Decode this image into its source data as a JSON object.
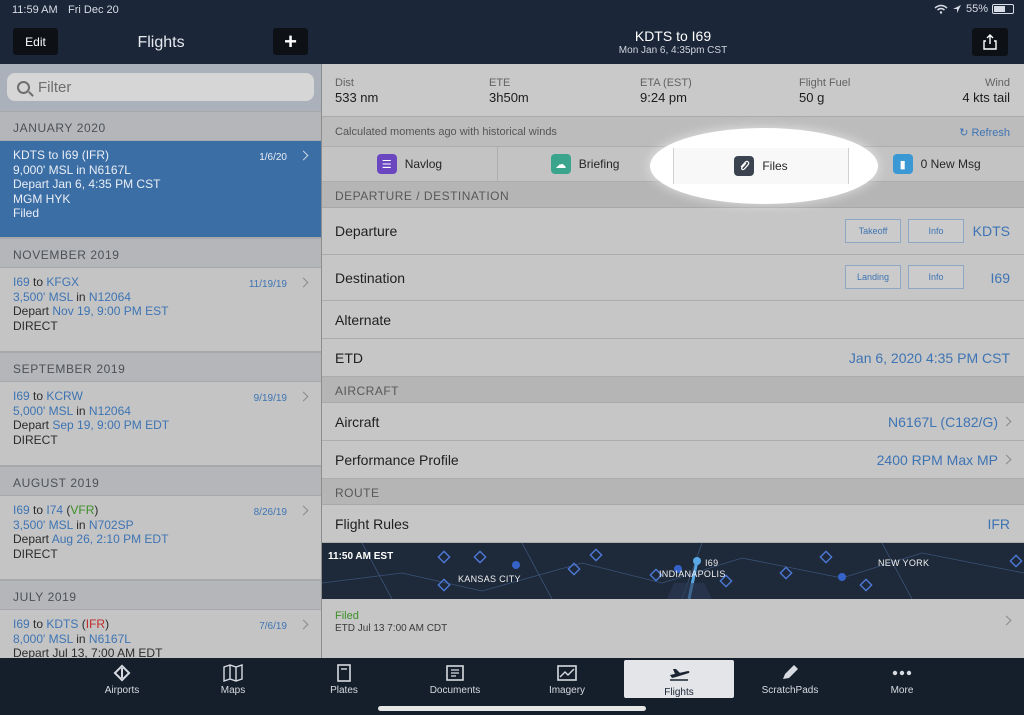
{
  "status": {
    "time": "11:59 AM",
    "date": "Fri Dec 20",
    "battery": "55%",
    "battery_fraction": 0.55
  },
  "left_header": {
    "edit": "Edit",
    "title": "Flights",
    "add": "+"
  },
  "right_header": {
    "title": "KDTS to I69",
    "subtitle": "Mon Jan 6, 4:35pm CST"
  },
  "filter": {
    "placeholder": "Filter"
  },
  "groups": [
    {
      "header": "JANUARY 2020",
      "flights": [
        {
          "route": "KDTS to I69 (IFR)",
          "alt": "9,000' MSL in N6167L",
          "depart": "Depart Jan 6, 4:35 PM CST",
          "extra": "MGM HYK",
          "status": "Filed",
          "date": "1/6/20"
        }
      ]
    },
    {
      "header": "NOVEMBER 2019",
      "flights": [
        {
          "from": "I69",
          "to_word": " to ",
          "dest": "KFGX",
          "alt_val": "3,500' MSL",
          "in": " in ",
          "tail": "N12064",
          "depart_word": "Depart ",
          "depart_val": "Nov 19, 9:00 PM EST",
          "route": "DIRECT",
          "date": "11/19/19"
        }
      ]
    },
    {
      "header": "SEPTEMBER 2019",
      "flights": [
        {
          "from": "I69",
          "to_word": " to ",
          "dest": "KCRW",
          "alt_val": "5,000' MSL",
          "in": " in ",
          "tail": "N12064",
          "depart_word": "Depart ",
          "depart_val": "Sep 19, 9:00 PM EDT",
          "route": "DIRECT",
          "date": "9/19/19"
        }
      ]
    },
    {
      "header": "AUGUST 2019",
      "flights": [
        {
          "from": "I69",
          "to_word": " to ",
          "dest": "I74",
          "rule": "VFR",
          "alt_val": "3,500' MSL",
          "in": " in ",
          "tail": "N702SP",
          "depart_word": "Depart ",
          "depart_val": "Aug 26, 2:10 PM EDT",
          "route": "DIRECT",
          "date": "8/26/19"
        }
      ]
    },
    {
      "header": "JULY 2019",
      "flights": [
        {
          "from": "I69",
          "to_word": " to ",
          "dest": "KDTS",
          "rule": "IFR",
          "alt_val": "8,000' MSL",
          "in": " in ",
          "tail": "N6167L",
          "depart_partial": "Depart Jul 13, 7:00 AM EDT",
          "date": "7/6/19"
        }
      ]
    }
  ],
  "stats": [
    {
      "label": "Dist",
      "value": "533 nm"
    },
    {
      "label": "ETE",
      "value": "3h50m"
    },
    {
      "label": "ETA (EST)",
      "value": "9:24 pm"
    },
    {
      "label": "Flight Fuel",
      "value": "50 g"
    },
    {
      "label": "Wind",
      "value": "4 kts tail"
    }
  ],
  "calc": {
    "text": "Calculated moments ago with historical winds",
    "refresh": "Refresh"
  },
  "tabs": [
    {
      "label": "Navlog",
      "color": "#6b46c1",
      "icon": "list-icon"
    },
    {
      "label": "Briefing",
      "color": "#3aa58c",
      "icon": "cloud-icon"
    },
    {
      "label": "Files",
      "color": "#3b4350",
      "icon": "paperclip-icon"
    },
    {
      "label": "0 New Msg",
      "color": "#3a98d4",
      "icon": "message-icon"
    }
  ],
  "sections": {
    "dep_dest": "DEPARTURE / DESTINATION",
    "aircraft": "AIRCRAFT",
    "route": "ROUTE"
  },
  "rows": {
    "departure": {
      "label": "Departure",
      "btn1": "Takeoff",
      "btn2": "Info",
      "value": "KDTS"
    },
    "destination": {
      "label": "Destination",
      "btn1": "Landing",
      "btn2": "Info",
      "value": "I69"
    },
    "alternate": {
      "label": "Alternate"
    },
    "etd": {
      "label": "ETD",
      "value": "Jan 6, 2020 4:35 PM CST"
    },
    "aircraft": {
      "label": "Aircraft",
      "value": "N6167L (C182/G)"
    },
    "profile": {
      "label": "Performance Profile",
      "value": "2400 RPM Max MP"
    },
    "rules": {
      "label": "Flight Rules",
      "value": "IFR"
    }
  },
  "map": {
    "time": "11:50 AM EST",
    "kc": "KANSAS CITY",
    "indy": "INDIANAPOLIS",
    "i69": "I69",
    "ny": "NEW YORK"
  },
  "filed": {
    "status": "Filed",
    "etd": "ETD Jul 13 7:00 AM CDT"
  },
  "tabbar": [
    {
      "label": "Airports"
    },
    {
      "label": "Maps"
    },
    {
      "label": "Plates"
    },
    {
      "label": "Documents"
    },
    {
      "label": "Imagery"
    },
    {
      "label": "Flights"
    },
    {
      "label": "ScratchPads"
    },
    {
      "label": "More"
    }
  ]
}
